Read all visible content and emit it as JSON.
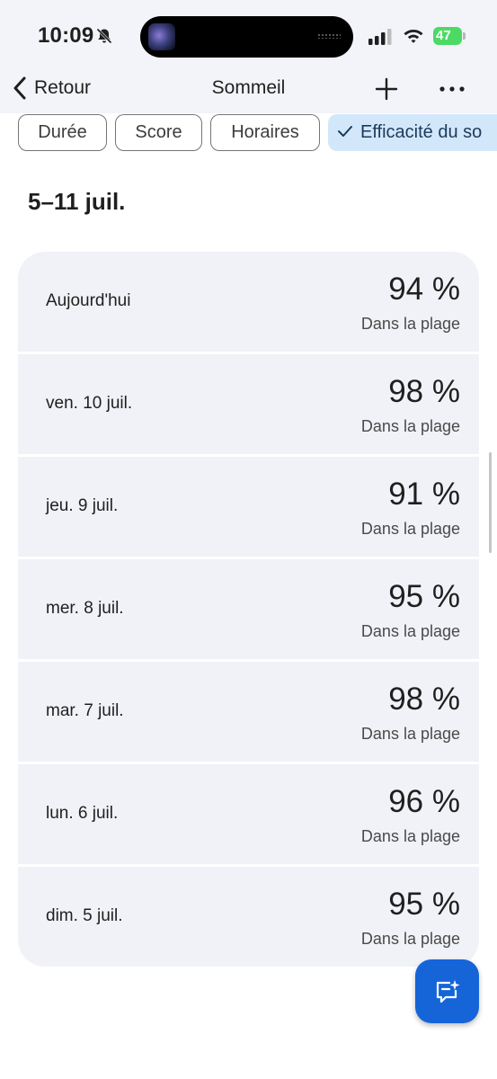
{
  "status_bar": {
    "time": "10:09",
    "battery": "47"
  },
  "nav": {
    "back_label": "Retour",
    "title": "Sommeil"
  },
  "filters": {
    "chips": [
      {
        "label": "Durée",
        "selected": false
      },
      {
        "label": "Score",
        "selected": false
      },
      {
        "label": "Horaires",
        "selected": false
      },
      {
        "label": "Efficacité du so",
        "selected": true
      }
    ]
  },
  "week": {
    "title": "5–11 juil."
  },
  "days": [
    {
      "label": "Aujourd'hui",
      "value": "94 %",
      "status": "Dans la plage"
    },
    {
      "label": "ven. 10 juil.",
      "value": "98 %",
      "status": "Dans la plage"
    },
    {
      "label": "jeu. 9 juil.",
      "value": "91 %",
      "status": "Dans la plage"
    },
    {
      "label": "mer. 8 juil.",
      "value": "95 %",
      "status": "Dans la plage"
    },
    {
      "label": "mar. 7 juil.",
      "value": "98 %",
      "status": "Dans la plage"
    },
    {
      "label": "lun. 6 juil.",
      "value": "96 %",
      "status": "Dans la plage"
    },
    {
      "label": "dim. 5 juil.",
      "value": "95 %",
      "status": "Dans la plage"
    }
  ],
  "colors": {
    "header_bg": "#f2f4f9",
    "row_bg": "#f0f2f7",
    "chip_selected_bg": "#d3e7fb",
    "fab_bg": "#1565d8",
    "battery_green": "#4cd964"
  },
  "icons": {
    "back": "chevron-left-icon",
    "add": "plus-icon",
    "more": "more-horizontal-icon",
    "check": "check-icon",
    "fab": "chat-sparkle-icon"
  }
}
